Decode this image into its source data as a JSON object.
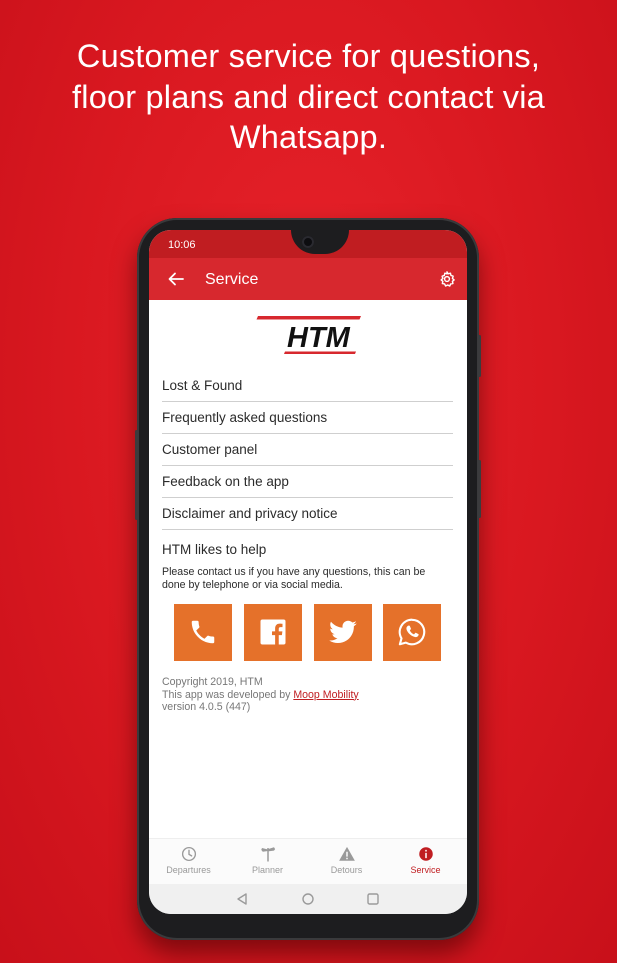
{
  "headline": {
    "line1": "Customer service for questions,",
    "line2": "floor plans and direct contact via",
    "line3": "Whatsapp."
  },
  "status_bar": {
    "time": "10:06"
  },
  "app_bar": {
    "title": "Service"
  },
  "logo": {
    "text": "HTM"
  },
  "menu": [
    {
      "label": "Lost & Found"
    },
    {
      "label": "Frequently asked questions"
    },
    {
      "label": "Customer panel"
    },
    {
      "label": "Feedback on the app"
    },
    {
      "label": "Disclaimer and privacy notice"
    }
  ],
  "help": {
    "title": "HTM likes to help",
    "text": "Please contact us if you have any questions, this can be done by telephone or via social media."
  },
  "social_buttons": [
    "phone-icon",
    "facebook-icon",
    "twitter-icon",
    "whatsapp-icon"
  ],
  "footer": {
    "copyright": "Copyright 2019, HTM",
    "developed_prefix": "This app was developed by ",
    "developer_link": "Moop Mobility",
    "version": "version 4.0.5 (447)"
  },
  "bottom_nav": [
    {
      "label": "Departures",
      "icon": "clock-icon"
    },
    {
      "label": "Planner",
      "icon": "signpost-icon"
    },
    {
      "label": "Detours",
      "icon": "warning-icon"
    },
    {
      "label": "Service",
      "icon": "info-icon",
      "active": true
    }
  ],
  "colors": {
    "brand_red": "#d7282e",
    "accent_orange": "#e5712a",
    "background_red": "#d91820"
  }
}
